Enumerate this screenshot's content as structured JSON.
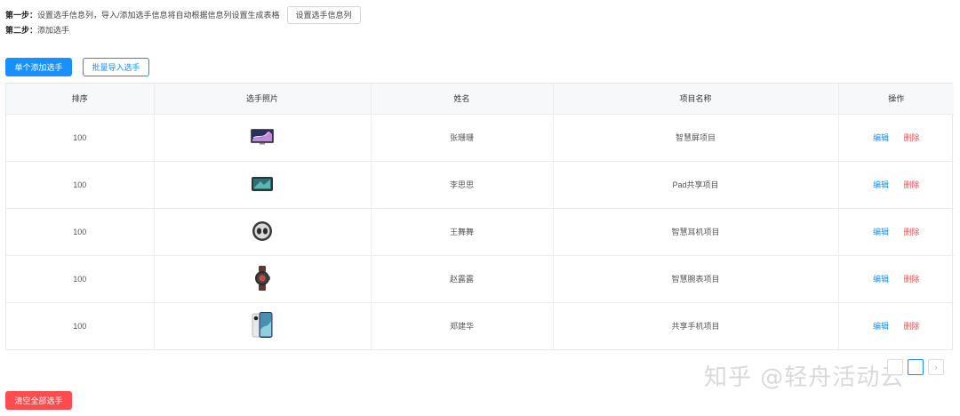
{
  "steps": {
    "step1_label": "第一步：",
    "step1_text": "设置选手信息列，导入/添加选手信息将自动根据信息列设置生成表格",
    "step1_button": "设置选手信息列",
    "step2_label": "第二步：",
    "step2_text": "添加选手"
  },
  "actions": {
    "add_single": "单个添加选手",
    "batch_import": "批量导入选手"
  },
  "table": {
    "headers": [
      "排序",
      "选手照片",
      "姓名",
      "项目名称",
      "操作"
    ],
    "rows": [
      {
        "order": "100",
        "photo_icon": "smart-screen-icon",
        "name": "张珊珊",
        "project": "智慧屏项目",
        "edit": "编辑",
        "delete": "删除"
      },
      {
        "order": "100",
        "photo_icon": "tablet-icon",
        "name": "李思思",
        "project": "Pad共享项目",
        "edit": "编辑",
        "delete": "删除"
      },
      {
        "order": "100",
        "photo_icon": "earbuds-case-icon",
        "name": "王舞舞",
        "project": "智慧耳机项目",
        "edit": "编辑",
        "delete": "删除"
      },
      {
        "order": "100",
        "photo_icon": "smartwatch-icon",
        "name": "赵露露",
        "project": "智慧腕表项目",
        "edit": "编辑",
        "delete": "删除"
      },
      {
        "order": "100",
        "photo_icon": "phone-icon",
        "name": "郑建华",
        "project": "共享手机项目",
        "edit": "编辑",
        "delete": "删除"
      }
    ]
  },
  "pagination": {
    "next_symbol": "›",
    "active_page_color": "#1890ff"
  },
  "watermark": "知乎 @轻舟活动云",
  "clear_all": "清空全部选手",
  "colors": {
    "primary": "#1890ff",
    "danger": "#ff4d4f",
    "header_bg": "#f7f8fa"
  }
}
